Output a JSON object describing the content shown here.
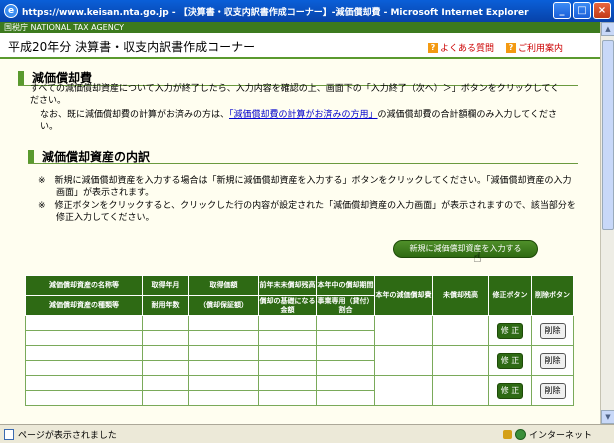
{
  "window": {
    "title": "https://www.keisan.nta.go.jp - 【決算書・収支内訳書作成コーナー】-減価償却費 - Microsoft Internet Explorer",
    "min": "_",
    "max": "□",
    "close": "×"
  },
  "header": {
    "agency": "国税庁 NATIONAL TAX AGENCY",
    "page_title": "平成20年分 決算書・収支内訳書作成コーナー",
    "faq": "よくある質問",
    "guide": "ご利用案内"
  },
  "section1": {
    "title": "減価償却費",
    "para1": "すべての減価償却資産について入力が終了したら、入力内容を確認の上、画面下の「入力終了（次へ）＞」ボタンをクリックしてください。",
    "para2_pre": "なお、既に減価償却費の計算がお済みの方は、",
    "para2_link": "「減価償却費の計算がお済みの方用」",
    "para2_post": "の減価償却費の合計額欄のみ入力してください。"
  },
  "section2": {
    "title": "減価償却資産の内訳",
    "note1": "※　新規に減価償却資産を入力する場合は「新規に減価償却資産を入力する」ボタンをクリックしてください。「減価償却資産の入力画面」が表示されます。",
    "note2": "※　修正ボタンをクリックすると、クリックした行の内容が設定された「減価償却資産の入力画面」が表示されますので、該当部分を修正入力してください。",
    "new_button": "新規に減価償却資産を入力する"
  },
  "table": {
    "h_name": "減価償却資産の名称等",
    "h_type": "減価償却資産の種類等",
    "h_date": "取得年月",
    "h_life": "耐用年数",
    "h_cost": "取得価額",
    "h_basis": "（償却保証額）",
    "h_unamort1": "前年末未償却残高",
    "h_base": "償却の基礎になる金額",
    "h_months": "本年中の償却期間",
    "h_ratio": "事業専用（貸付）割合",
    "h_dep": "本年の減価償却費",
    "h_remaining": "未償却残高",
    "h_edit": "修正ボタン",
    "h_delete": "削除ボタン",
    "edit_label": "修 正",
    "delete_label": "削除"
  },
  "statusbar": {
    "text": "ページが表示されました",
    "zone": "インターネット"
  }
}
